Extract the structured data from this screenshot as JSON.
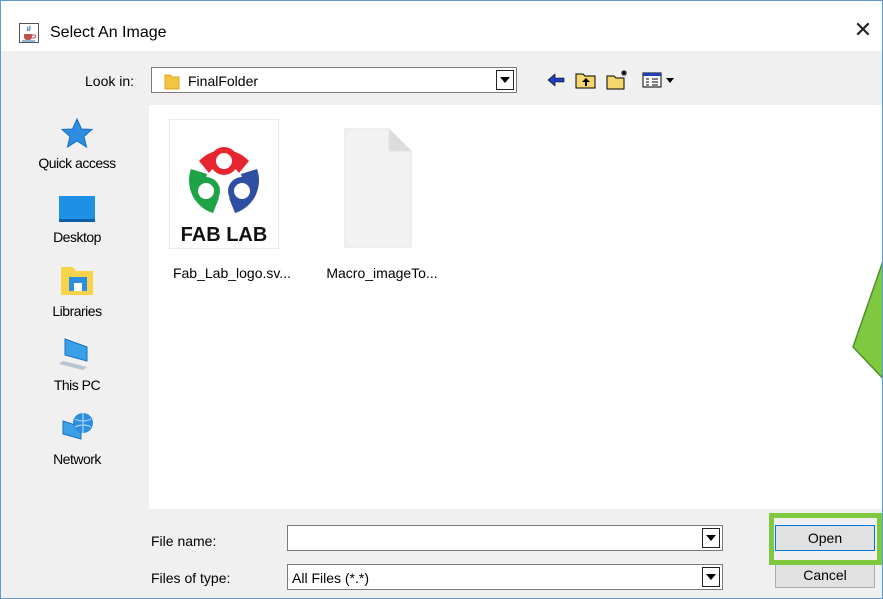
{
  "window": {
    "title": "Select An Image",
    "app_icon": "java-cup-icon",
    "close_glyph": "✕"
  },
  "toolbar": {
    "look_in_label": "Look in:",
    "look_in_value": "FinalFolder",
    "buttons": [
      "back-icon",
      "up-folder-icon",
      "new-folder-icon",
      "view-menu-icon"
    ]
  },
  "places": [
    {
      "label": "Quick access",
      "icon": "star-icon"
    },
    {
      "label": "Desktop",
      "icon": "desktop-icon"
    },
    {
      "label": "Libraries",
      "icon": "libraries-icon"
    },
    {
      "label": "This PC",
      "icon": "computer-icon"
    },
    {
      "label": "Network",
      "icon": "network-icon"
    }
  ],
  "files": [
    {
      "name": "Fab_Lab_logo.sv...",
      "thumbnail": "fab-lab-logo",
      "logo_text": "FAB LAB"
    },
    {
      "name": "Macro_imageTo...",
      "thumbnail": "blank-document"
    }
  ],
  "bottom": {
    "file_name_label": "File name:",
    "file_name_value": "",
    "files_of_type_label": "Files of type:",
    "files_of_type_value": "All Files (*.*)",
    "open_label": "Open",
    "cancel_label": "Cancel"
  },
  "colors": {
    "highlight": "#7fc941",
    "arrow": "#7fc941",
    "window_border": "#5b9bd5"
  }
}
